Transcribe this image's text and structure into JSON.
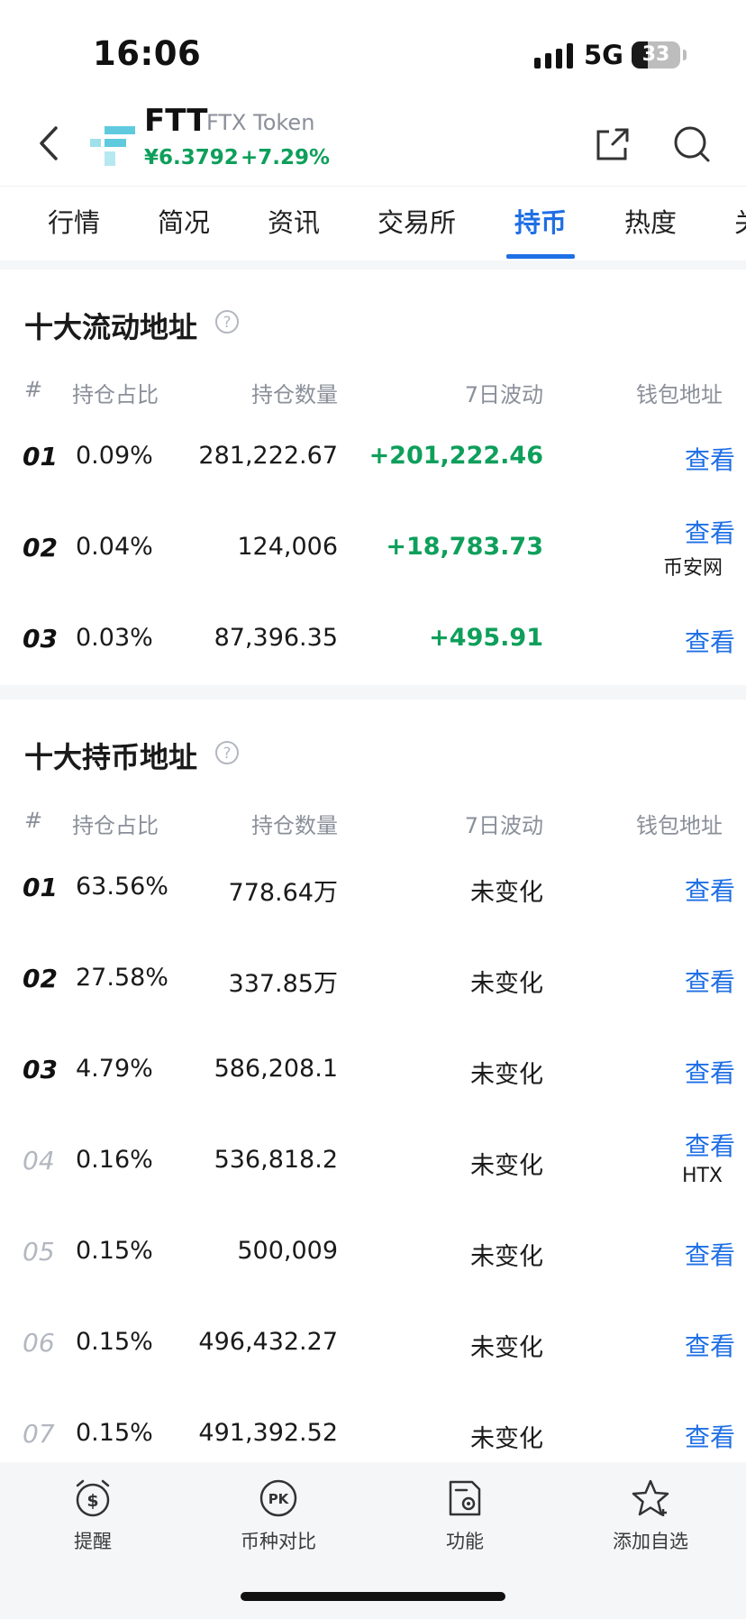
{
  "status_bar": {
    "time": "16:06",
    "network": "5G",
    "battery_level": "33",
    "battery_fraction": 0.33
  },
  "header": {
    "symbol": "FTT",
    "name": "FTX Token",
    "price": "¥6.3792",
    "change": "+7.29%",
    "accent_color": "#0e9f5b"
  },
  "tabs": [
    {
      "label": "行情"
    },
    {
      "label": "简况"
    },
    {
      "label": "资讯"
    },
    {
      "label": "交易所"
    },
    {
      "label": "持币",
      "active": true
    },
    {
      "label": "热度"
    },
    {
      "label": "关"
    }
  ],
  "liquid": {
    "title": "十大流动地址",
    "headers": {
      "rank": "#",
      "share": "持仓占比",
      "amount": "持仓数量",
      "change": "7日波动",
      "wallet": "钱包地址"
    },
    "rows": [
      {
        "rank": "01",
        "share": "0.09%",
        "amount": "281,222.67",
        "change": "+201,222.46",
        "link": "查看",
        "tag": ""
      },
      {
        "rank": "02",
        "share": "0.04%",
        "amount": "124,006",
        "change": "+18,783.73",
        "link": "查看",
        "tag": "币安网"
      },
      {
        "rank": "03",
        "share": "0.03%",
        "amount": "87,396.35",
        "change": "+495.91",
        "link": "查看",
        "tag": ""
      }
    ]
  },
  "holders": {
    "title": "十大持币地址",
    "headers": {
      "rank": "#",
      "share": "持仓占比",
      "amount": "持仓数量",
      "change": "7日波动",
      "wallet": "钱包地址"
    },
    "rows": [
      {
        "rank": "01",
        "share": "63.56%",
        "amount": "778.64万",
        "change": "未变化",
        "link": "查看",
        "tag": ""
      },
      {
        "rank": "02",
        "share": "27.58%",
        "amount": "337.85万",
        "change": "未变化",
        "link": "查看",
        "tag": ""
      },
      {
        "rank": "03",
        "share": "4.79%",
        "amount": "586,208.1",
        "change": "未变化",
        "link": "查看",
        "tag": ""
      },
      {
        "rank": "04",
        "share": "0.16%",
        "amount": "536,818.2",
        "change": "未变化",
        "link": "查看",
        "tag": "HTX"
      },
      {
        "rank": "05",
        "share": "0.15%",
        "amount": "500,009",
        "change": "未变化",
        "link": "查看",
        "tag": ""
      },
      {
        "rank": "06",
        "share": "0.15%",
        "amount": "496,432.27",
        "change": "未变化",
        "link": "查看",
        "tag": ""
      },
      {
        "rank": "07",
        "share": "0.15%",
        "amount": "491,392.52",
        "change": "未变化",
        "link": "查看",
        "tag": ""
      }
    ]
  },
  "bottom_bar": [
    {
      "label": "提醒",
      "icon": "alarm-dollar-icon"
    },
    {
      "label": "币种对比",
      "icon": "pk-icon"
    },
    {
      "label": "功能",
      "icon": "function-icon"
    },
    {
      "label": "添加自选",
      "icon": "star-icon"
    }
  ]
}
